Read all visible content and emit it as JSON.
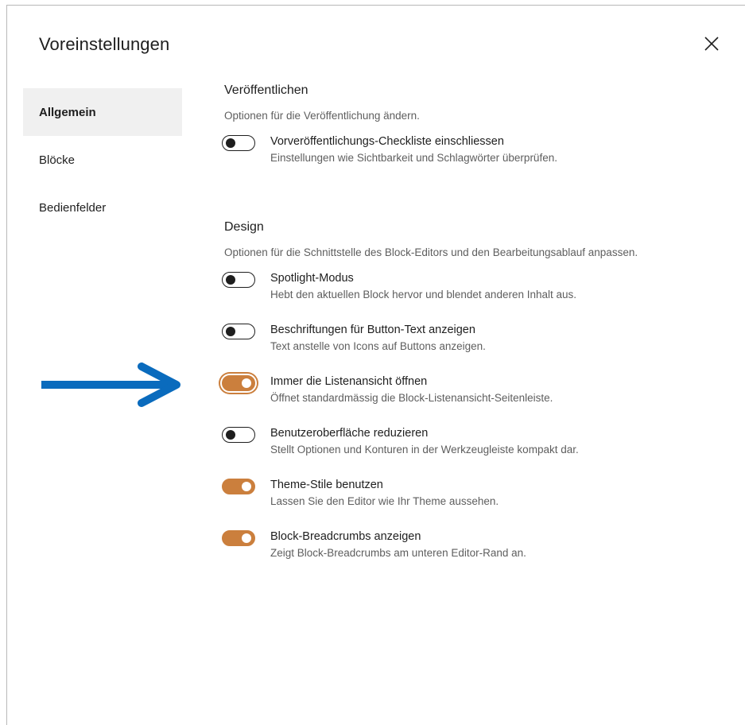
{
  "dialog": {
    "title": "Voreinstellungen",
    "close_icon": "close-icon"
  },
  "sidebar": {
    "items": [
      {
        "label": "Allgemein",
        "active": true
      },
      {
        "label": "Blöcke",
        "active": false
      },
      {
        "label": "Bedienfelder",
        "active": false
      }
    ]
  },
  "sections": {
    "publish": {
      "title": "Veröffentlichen",
      "description": "Optionen für die Veröffentlichung ändern.",
      "options": [
        {
          "label": "Vorveröffentlichungs-Checkliste einschliessen",
          "help": "Einstellungen wie Sichtbarkeit und Schlagwörter überprüfen.",
          "checked": false
        }
      ]
    },
    "design": {
      "title": "Design",
      "description": "Optionen für die Schnittstelle des Block-Editors und den Bearbeitungsablauf anpassen.",
      "options": [
        {
          "label": "Spotlight-Modus",
          "help": "Hebt den aktuellen Block hervor und blendet anderen Inhalt aus.",
          "checked": false
        },
        {
          "label": "Beschriftungen für Button-Text anzeigen",
          "help": "Text anstelle von Icons auf Buttons anzeigen.",
          "checked": false
        },
        {
          "label": "Immer die Listenansicht öffnen",
          "help": "Öffnet standardmässig die Block-Listenansicht-Seitenleiste.",
          "checked": true,
          "focused": true
        },
        {
          "label": "Benutzeroberfläche reduzieren",
          "help": "Stellt Optionen und Konturen in der Werkzeugleiste kompakt dar.",
          "checked": false
        },
        {
          "label": "Theme-Stile benutzen",
          "help": "Lassen Sie den Editor wie Ihr Theme aussehen.",
          "checked": true
        },
        {
          "label": "Block-Breadcrumbs anzeigen",
          "help": "Zeigt Block-Breadcrumbs am unteren Editor-Rand an.",
          "checked": true
        }
      ]
    }
  },
  "annotation": {
    "arrow_icon": "arrow-right-icon",
    "color": "#0a6bbd"
  },
  "colors": {
    "accent": "#cb7f3d",
    "text": "#1e1e1e",
    "muted": "#5e5e5e",
    "active_bg": "#f0f0f0"
  }
}
